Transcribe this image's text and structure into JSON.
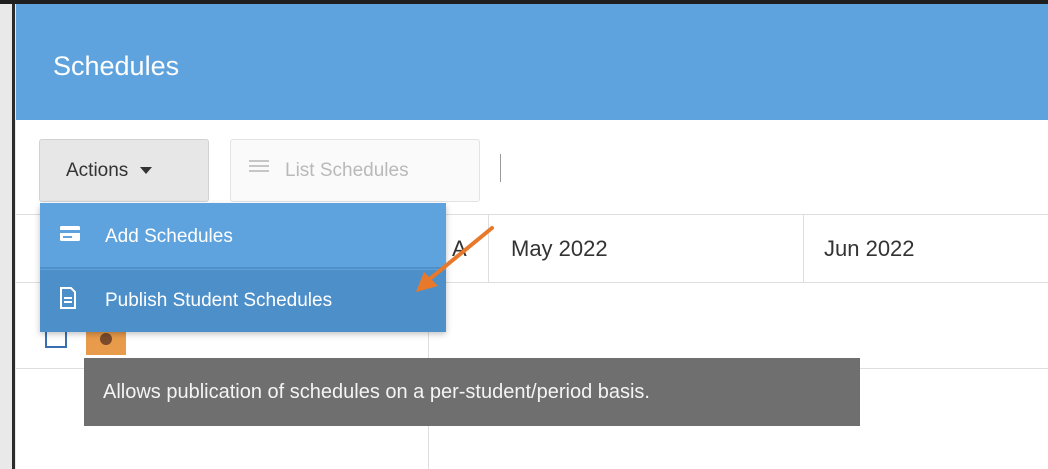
{
  "header": {
    "title": "Schedules"
  },
  "toolbar": {
    "actions_label": "Actions",
    "list_label": "List Schedules"
  },
  "grid": {
    "partial_header": "A",
    "columns": [
      "May 2022",
      "Jun 2022"
    ]
  },
  "menu": {
    "items": [
      {
        "label": "Add Schedules",
        "icon": "card-icon"
      },
      {
        "label": "Publish Student Schedules",
        "icon": "document-icon"
      }
    ]
  },
  "tooltip": {
    "text": "Allows publication of schedules on a per-student/period basis."
  },
  "colors": {
    "header_bg": "#5ea3dd",
    "menu_bg": "#5ea3dd",
    "menu_hover": "#4d8fc9",
    "tooltip_bg": "#6f6f6f",
    "annotation_arrow": "#e8782a"
  }
}
